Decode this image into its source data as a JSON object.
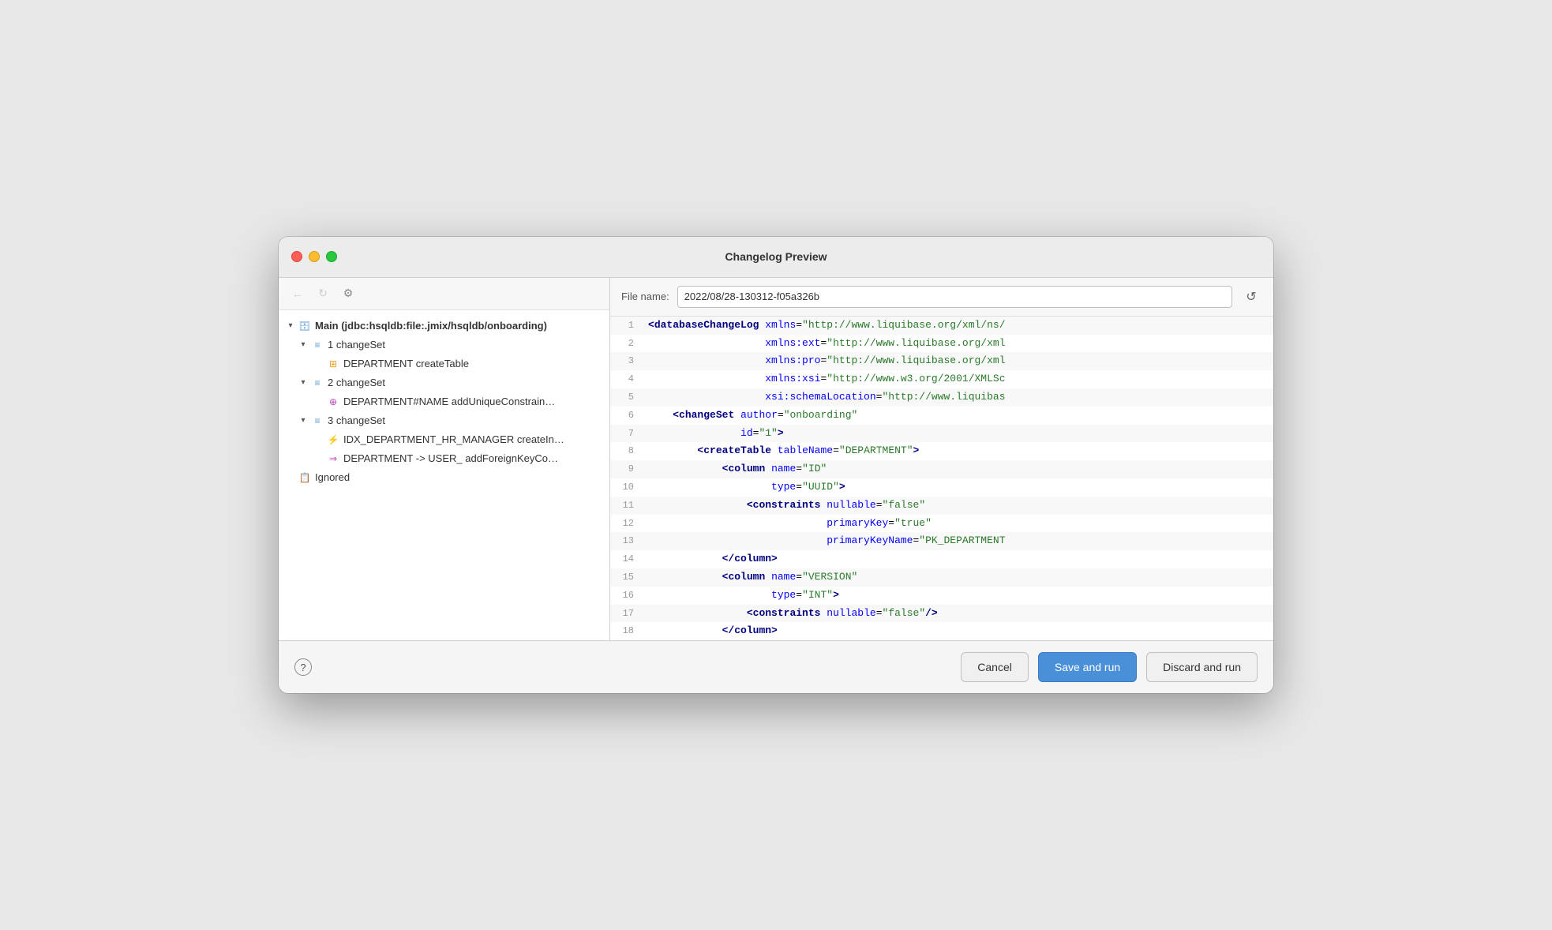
{
  "window": {
    "title": "Changelog Preview"
  },
  "toolbar": {
    "back_label": "←",
    "forward_label": "→",
    "settings_label": "⚙"
  },
  "tree": {
    "items": [
      {
        "indent": 0,
        "chevron": "▾",
        "icon": "db",
        "text": "Main (jdbc:hsqldb:file:.jmix/hsqldb/onboarding)",
        "bold": true
      },
      {
        "indent": 1,
        "chevron": "▾",
        "icon": "changeset",
        "text": "1 changeSet",
        "bold": false
      },
      {
        "indent": 2,
        "chevron": "",
        "icon": "table",
        "text": "DEPARTMENT createTable",
        "bold": false
      },
      {
        "indent": 1,
        "chevron": "▾",
        "icon": "changeset",
        "text": "2 changeSet",
        "bold": false
      },
      {
        "indent": 2,
        "chevron": "",
        "icon": "constraint",
        "text": "DEPARTMENT#NAME addUniqueConstrain…",
        "bold": false
      },
      {
        "indent": 1,
        "chevron": "▾",
        "icon": "changeset",
        "text": "3 changeSet",
        "bold": false
      },
      {
        "indent": 2,
        "chevron": "",
        "icon": "index",
        "text": "IDX_DEPARTMENT_HR_MANAGER createIn…",
        "bold": false
      },
      {
        "indent": 2,
        "chevron": "",
        "icon": "fk",
        "text": "DEPARTMENT -> USER_ addForeignKeyCo…",
        "bold": false
      },
      {
        "indent": 0,
        "chevron": "",
        "icon": "ignored",
        "text": "Ignored",
        "bold": false
      }
    ]
  },
  "file_header": {
    "label": "File name:",
    "value": "2022/08/28-130312-f05a326b",
    "reset_tooltip": "Reset"
  },
  "code": {
    "lines": [
      {
        "num": 1,
        "content": "<databaseChangeLog xmlns=\"http://www.liquibase.org/xml/ns/"
      },
      {
        "num": 2,
        "content": "                   xmlns:ext=\"http://www.liquibase.org/xml"
      },
      {
        "num": 3,
        "content": "                   xmlns:pro=\"http://www.liquibase.org/xml"
      },
      {
        "num": 4,
        "content": "                   xmlns:xsi=\"http://www.w3.org/2001/XMLSc"
      },
      {
        "num": 5,
        "content": "                   xsi:schemaLocation=\"http://www.liquibas"
      },
      {
        "num": 6,
        "content": "    <changeSet author=\"onboarding\""
      },
      {
        "num": 7,
        "content": "               id=\"1\">"
      },
      {
        "num": 8,
        "content": "        <createTable tableName=\"DEPARTMENT\">"
      },
      {
        "num": 9,
        "content": "            <column name=\"ID\""
      },
      {
        "num": 10,
        "content": "                    type=\"UUID\">"
      },
      {
        "num": 11,
        "content": "                <constraints nullable=\"false\""
      },
      {
        "num": 12,
        "content": "                             primaryKey=\"true\""
      },
      {
        "num": 13,
        "content": "                             primaryKeyName=\"PK_DEPARTMENT"
      },
      {
        "num": 14,
        "content": "            </column>"
      },
      {
        "num": 15,
        "content": "            <column name=\"VERSION\""
      },
      {
        "num": 16,
        "content": "                    type=\"INT\">"
      },
      {
        "num": 17,
        "content": "                <constraints nullable=\"false\"/>"
      },
      {
        "num": 18,
        "content": "            </column>"
      }
    ]
  },
  "buttons": {
    "help": "?",
    "cancel": "Cancel",
    "save_and_run": "Save and run",
    "discard_and_run": "Discard and run"
  }
}
